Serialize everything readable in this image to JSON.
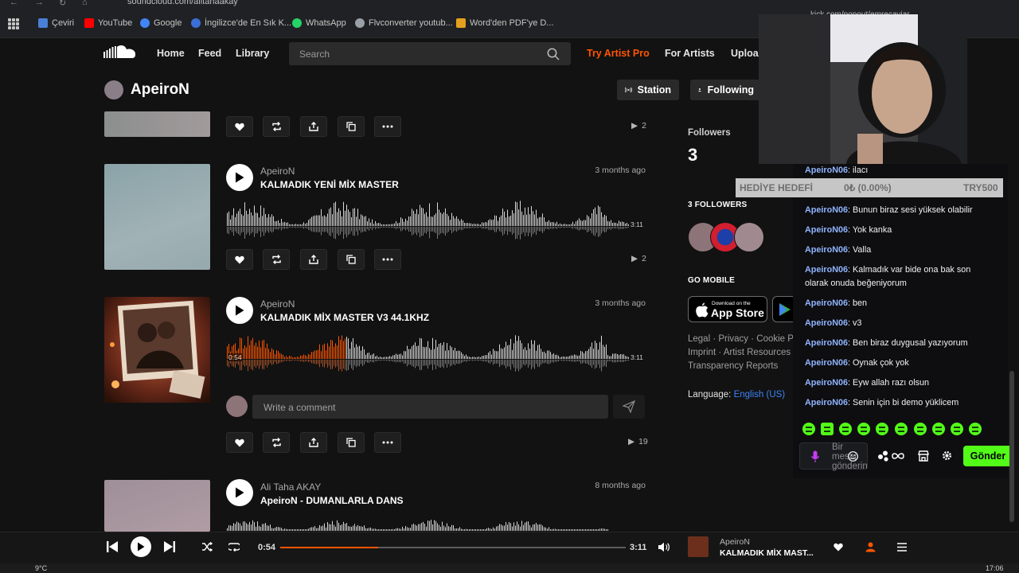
{
  "browser": {
    "url": "soundcloud.com/alitahaakay",
    "bookmarks": [
      {
        "label": "Çeviri",
        "color": "#4a7fd6"
      },
      {
        "label": "YouTube",
        "color": "#ff0000"
      },
      {
        "label": "Google",
        "color": "#4285f4"
      },
      {
        "label": "İngilizce'de En Sık K...",
        "color": "#3b6fd8"
      },
      {
        "label": "WhatsApp",
        "color": "#25d366"
      },
      {
        "label": "Flvconverter youtub...",
        "color": "#9aa0a6"
      },
      {
        "label": "Word'den PDF'ye D...",
        "color": "#e5a01f"
      }
    ]
  },
  "header": {
    "nav": [
      "Home",
      "Feed",
      "Library"
    ],
    "search_placeholder": "Search",
    "try_pro": "Try Artist Pro",
    "for_artists": "For Artists",
    "upload": "Uploa"
  },
  "profile": {
    "name": "ApeiroN",
    "station_label": "Station",
    "following_label": "Following"
  },
  "tracks": [
    {
      "plays": "2"
    },
    {
      "artist": "ApeiroN",
      "title": "KALMADIK YENİ MİX MASTER",
      "ago": "3 months ago",
      "duration": "3:11",
      "plays": "2",
      "progress": 0
    },
    {
      "artist": "ApeiroN",
      "title": "KALMADIK MİX MASTER V3 44.1KHZ",
      "ago": "3 months ago",
      "duration": "3:11",
      "position": "0:54",
      "plays": "19",
      "progress": 0.283
    },
    {
      "artist": "Ali Taha AKAY",
      "title": "ApeiroN - DUMANLARLA DANS",
      "ago": "8 months ago"
    }
  ],
  "comment": {
    "placeholder": "Write a comment"
  },
  "sidebar": {
    "followers_label": "Followers",
    "followers_count": "3",
    "followers_heading": "3 FOLLOWERS",
    "go_mobile": "GO MOBILE",
    "app_store_small": "Download on the",
    "app_store_big": "App Store",
    "links_line1": "Legal · Privacy · Cookie Po",
    "links_line2": "Imprint · Artist Resources",
    "links_line3": "Transparency Reports",
    "language_label": "Language:",
    "language_value": "English (US)"
  },
  "kick": {
    "popout_url": "kick.com/popout/emrecaviar",
    "goal_label": "HEDİYE HEDEFİ",
    "goal_value": "0₺ (0.00%)",
    "goal_target": "TRY500",
    "messages": [
      {
        "user": "ApeiroN06",
        "text": "ilacı"
      },
      {
        "user": "ApeiroN06",
        "text": "Bunun biraz sesi yüksek olabilir"
      },
      {
        "user": "ApeiroN06",
        "text": "Yok kanka"
      },
      {
        "user": "ApeiroN06",
        "text": "Valla"
      },
      {
        "user": "ApeiroN06",
        "text": "Kalmadık var bide ona bak son olarak onuda beğeniyorum"
      },
      {
        "user": "ApeiroN06",
        "text": "ben"
      },
      {
        "user": "ApeiroN06",
        "text": "v3"
      },
      {
        "user": "ApeiroN06",
        "text": "Ben biraz duygusal yazıyorum"
      },
      {
        "user": "ApeiroN06",
        "text": "Oynak çok yok"
      },
      {
        "user": "ApeiroN06",
        "text": "Eyw allah razı olsun"
      },
      {
        "user": "ApeiroN06",
        "text": "Senin için bi demo yüklicem"
      }
    ],
    "input_placeholder": "Bir mesaj gönderin",
    "send_label": "Gönder",
    "emote_color": "#53fc18"
  },
  "player": {
    "elapsed": "0:54",
    "duration": "3:11",
    "progress": 0.283,
    "artist": "ApeiroN",
    "title": "KALMADIK MİX MAST..."
  },
  "taskbar": {
    "temp": "9°C",
    "clock": "17:06"
  },
  "colors": {
    "accent": "#ff5500",
    "kick_green": "#53fc18",
    "link_blue": "#3b82f6"
  }
}
